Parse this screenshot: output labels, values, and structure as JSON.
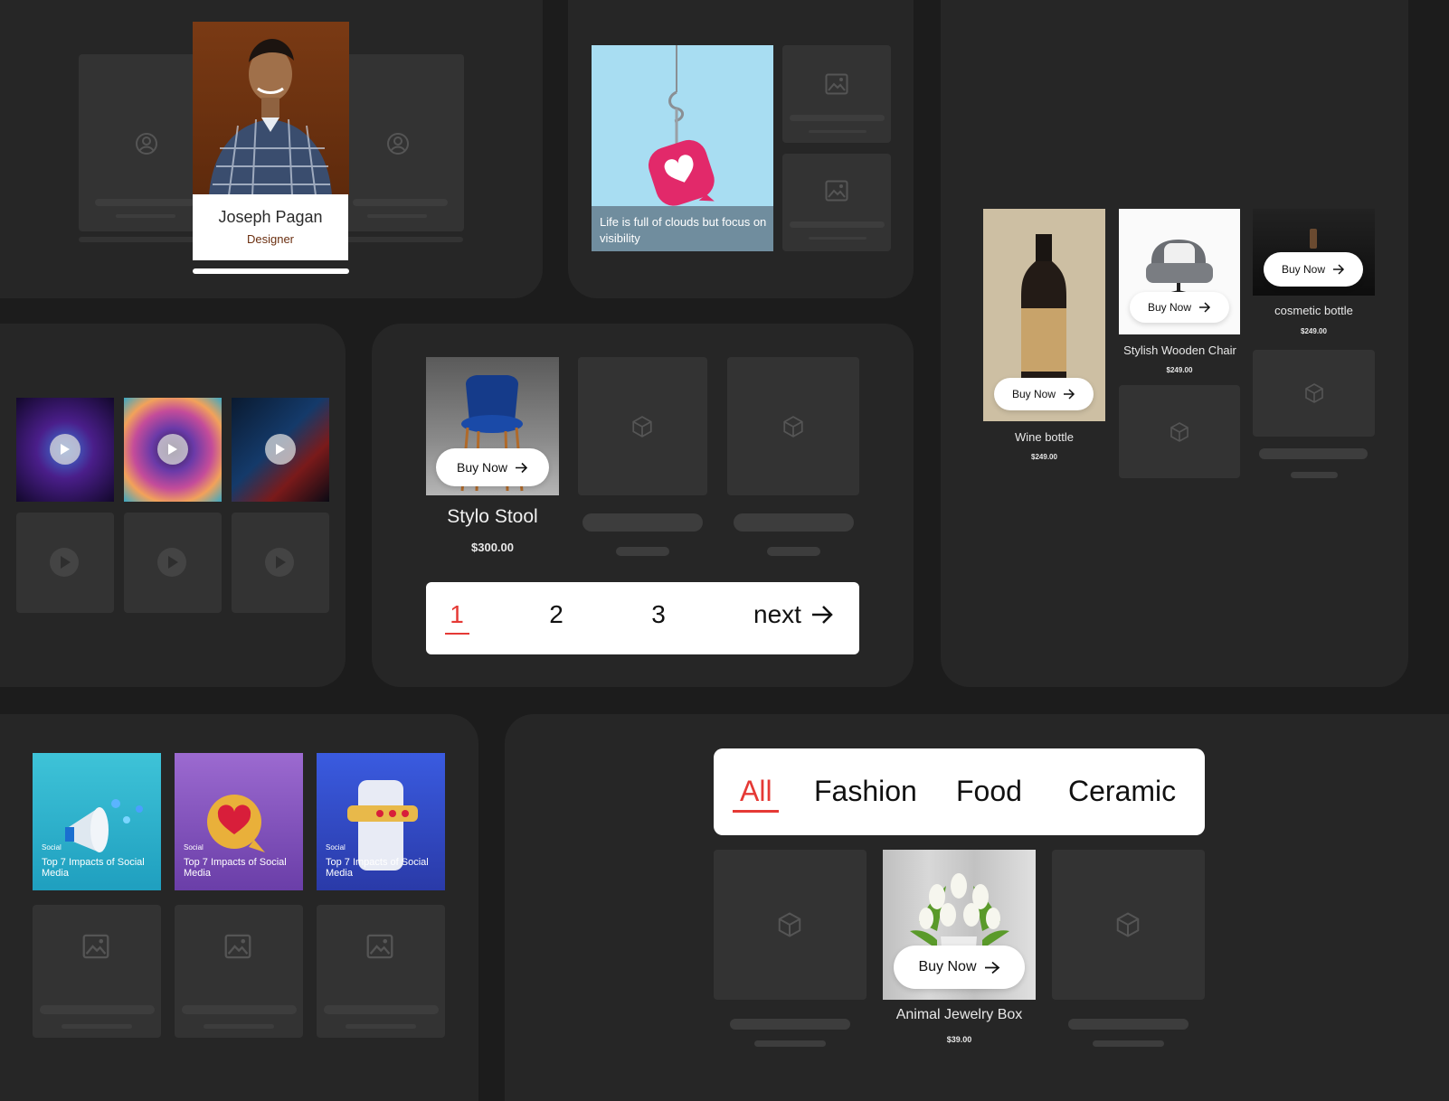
{
  "profile": {
    "name": "Joseph Pagan",
    "role": "Designer"
  },
  "hook_card": {
    "caption": "Life is full of clouds but focus on visibility"
  },
  "product_grid": {
    "stool": {
      "name": "Stylo Stool",
      "price": "$300.00",
      "buy_label": "Buy Now"
    },
    "pagination": {
      "pages": [
        "1",
        "2",
        "3"
      ],
      "next_label": "next",
      "active": "1"
    }
  },
  "right_products": {
    "wine": {
      "name": "Wine bottle",
      "price": "$249.00",
      "buy_label": "Buy Now"
    },
    "chair": {
      "name": "Stylish Wooden Chair",
      "price": "$249.00",
      "buy_label": "Buy Now"
    },
    "cosmetic": {
      "name": "cosmetic bottle",
      "price": "$249.00",
      "buy_label": "Buy Now"
    }
  },
  "social_cards": [
    {
      "tag": "Social",
      "title": "Top 7 Impacts of Social Media"
    },
    {
      "tag": "Social",
      "title": "Top 7 Impacts of Social Media"
    },
    {
      "tag": "Social",
      "title": "Top 7 Impacts of Social Media"
    }
  ],
  "filter_tabs": {
    "tabs": [
      "All",
      "Fashion",
      "Food",
      "Ceramic"
    ],
    "active": "All"
  },
  "jewelry": {
    "name": "Animal Jewelry Box",
    "price": "$39.00",
    "buy_label": "Buy Now"
  },
  "colors": {
    "accent": "#e53935",
    "panel": "#262626",
    "placeholder": "#333333"
  }
}
